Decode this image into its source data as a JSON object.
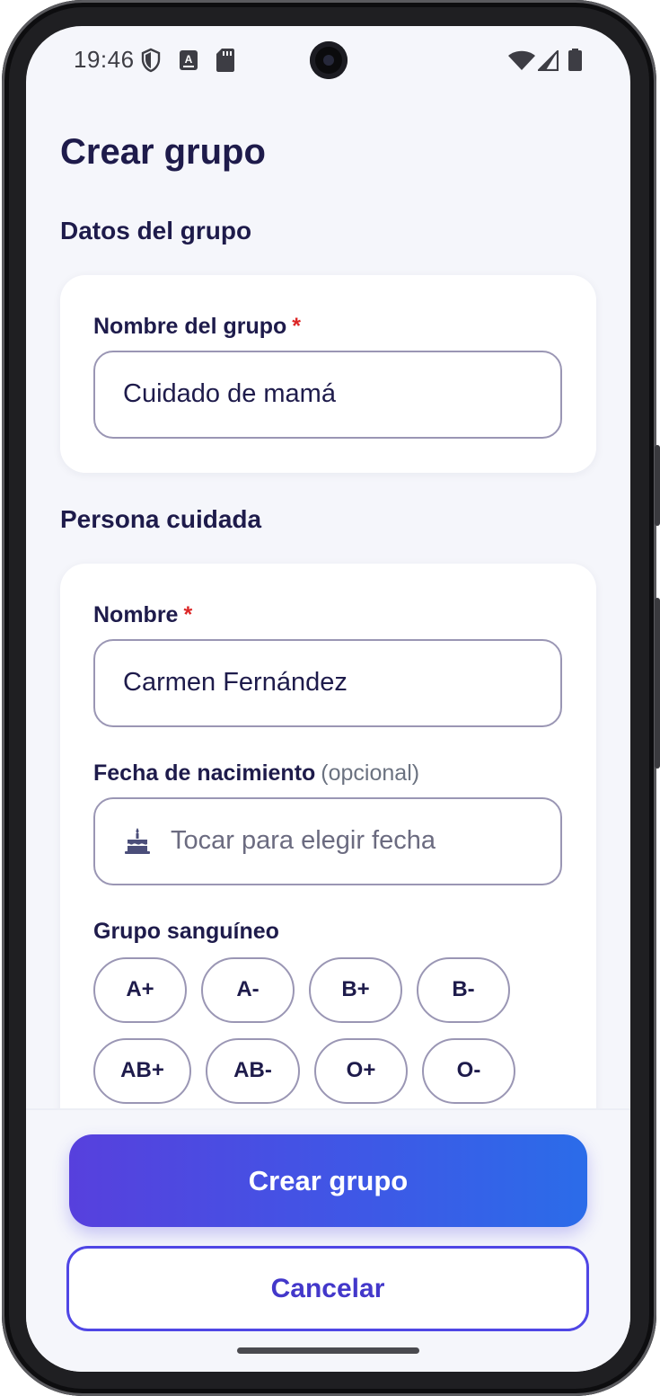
{
  "status_bar": {
    "time": "19:46",
    "left_icons": [
      "shield-icon",
      "font-a-icon",
      "sd-card-icon"
    ],
    "right_icons": [
      "wifi-icon",
      "signal-icon",
      "battery-icon"
    ]
  },
  "page": {
    "title": "Crear grupo"
  },
  "group_section": {
    "title": "Datos del grupo",
    "name_field": {
      "label": "Nombre del grupo",
      "required_mark": "*",
      "value": "Cuidado de mamá"
    }
  },
  "person_section": {
    "title": "Persona cuidada",
    "name_field": {
      "label": "Nombre",
      "required_mark": "*",
      "value": "Carmen Fernández"
    },
    "birthdate_field": {
      "label": "Fecha de nacimiento",
      "optional_note": "(opcional)",
      "placeholder": "Tocar para elegir fecha",
      "icon": "cake-icon"
    },
    "blood_type": {
      "label": "Grupo sanguíneo",
      "options": [
        "A+",
        "A-",
        "B+",
        "B-",
        "AB+",
        "AB-",
        "O+",
        "O-"
      ]
    }
  },
  "actions": {
    "create_label": "Crear grupo",
    "cancel_label": "Cancelar"
  },
  "colors": {
    "heading": "#1e1b4b",
    "required": "#dc2626",
    "accent": "#4f46e5",
    "gradient_start": "#5740dd",
    "gradient_end": "#2b6ce9",
    "background": "#f5f6fb"
  }
}
